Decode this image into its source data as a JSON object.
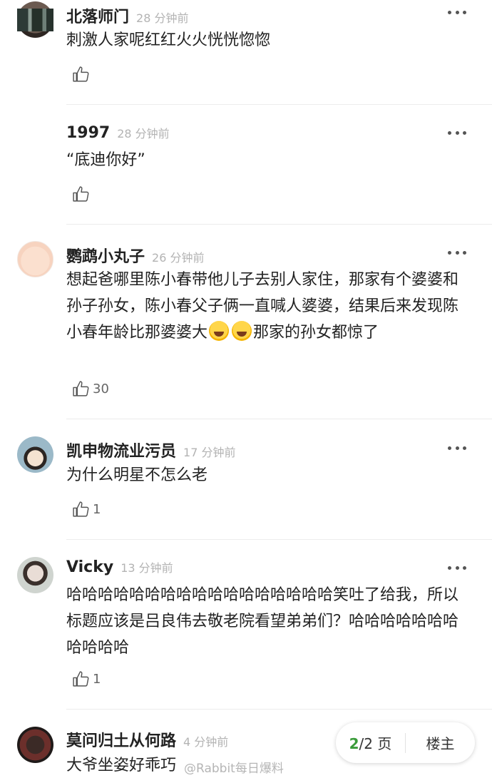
{
  "comments": [
    {
      "name": "北落师门",
      "time": "28 分钟前",
      "text": "刺激人家呢红红火火恍恍惚惚",
      "likes": ""
    },
    {
      "name": "1997",
      "time": "28 分钟前",
      "text": "“底迪你好”",
      "likes": ""
    },
    {
      "name": "鹦鹉小丸子",
      "time": "26 分钟前",
      "text_before": "想起爸哪里陈小春带他儿子去别人家住，那家有个婆婆和孙子孙女，陈小春父子俩一直喊人婆婆，结果后来发现陈小春年龄比那婆婆大",
      "text_after": "那家的孙女都惊了",
      "likes": "30"
    },
    {
      "name": "凯申物流业污员",
      "time": "17 分钟前",
      "text": "为什么明星不怎么老",
      "likes": "1"
    },
    {
      "name": "Vicky",
      "time": "13 分钟前",
      "text": "哈哈哈哈哈哈哈哈哈哈哈哈哈哈哈哈哈笑吐了给我，所以标题应该是吕良伟去敬老院看望弟弟们？哈哈哈哈哈哈哈哈哈哈哈",
      "likes": "1"
    },
    {
      "name": "莫问归土从何路",
      "time": "4 分钟前",
      "text": "大爷坐姿好乖巧",
      "likes": ""
    }
  ],
  "icons": {
    "more": "more-dots-icon",
    "like": "thumbs-up-icon",
    "emoji": "laugh-cry-emoji-icon"
  },
  "pager": {
    "current": "2",
    "total_text": "/2 页",
    "owner_label": "楼主"
  },
  "watermark": "@Rabbit每日爆料",
  "colors": {
    "accent": "#3a9b3a",
    "time": "#b3b3b3",
    "divider": "#ececec"
  }
}
